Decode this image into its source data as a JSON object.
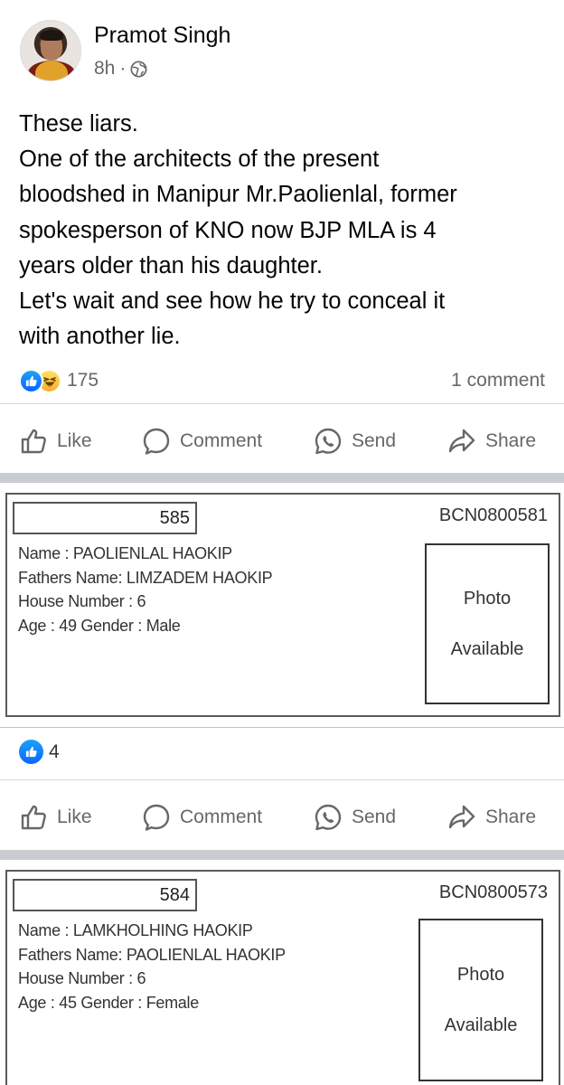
{
  "post": {
    "author": "Pramot Singh",
    "time": "8h",
    "separator": "·",
    "privacy_icon": "globe-icon",
    "text_lines": [
      "These liars.",
      "One of the architects of the present",
      "bloodshed in Manipur Mr.Paolienlal, former",
      "spokesperson of KNO now BJP MLA is 4",
      "years older than his daughter.",
      "Let's wait and see how he try to conceal it",
      "with another lie."
    ],
    "reaction_icons": [
      "like-icon",
      "haha-icon"
    ],
    "reaction_count": "175",
    "comment_count": "1 comment"
  },
  "actions": {
    "like": "Like",
    "comment": "Comment",
    "send": "Send",
    "share": "Share"
  },
  "cards": [
    {
      "serial": "585",
      "code": "BCN0800581",
      "name_line": "Name : PAOLIENLAL HAOKIP",
      "father_line": "Fathers Name: LIMZADEM HAOKIP",
      "house_line": "House Number : 6",
      "age_gender_line": "Age : 49 Gender : Male",
      "photo_line1": "Photo",
      "photo_line2": "Available"
    },
    {
      "serial": "584",
      "code": "BCN0800573",
      "name_line": "Name : LAMKHOLHING HAOKIP",
      "father_line": "Fathers Name: PAOLIENLAL HAOKIP",
      "house_line": "House Number : 6",
      "age_gender_line": "Age : 45 Gender : Female",
      "photo_line1": "Photo",
      "photo_line2": "Available"
    }
  ],
  "shared_post": {
    "reaction_icon": "like-icon",
    "reaction_count": "4"
  },
  "colors": {
    "meta_gray": "#65676b",
    "like_blue": "#0866ff",
    "haha_yellow": "#f7b125",
    "divider": "#d6d8dc",
    "section_gap": "#c9ccd1"
  }
}
